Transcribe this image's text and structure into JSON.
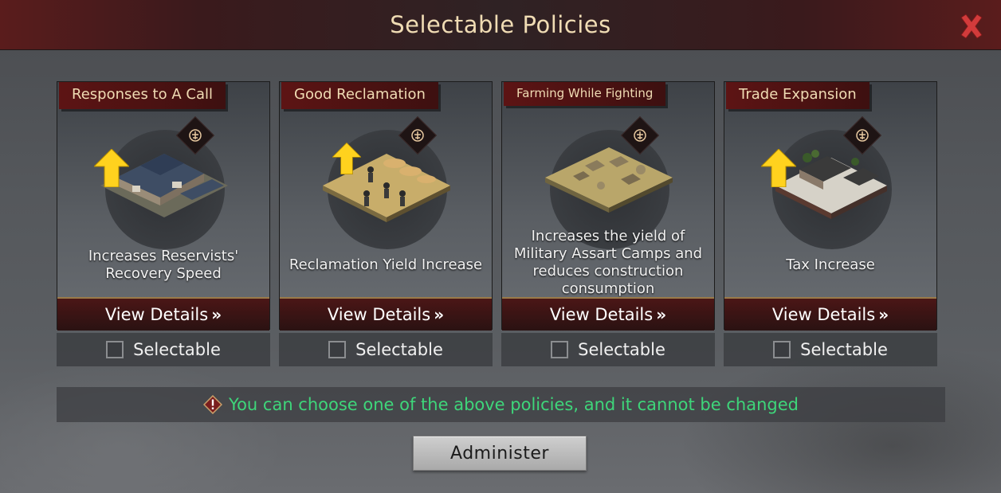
{
  "header": {
    "title": "Selectable Policies"
  },
  "close_icon": "close-x-icon",
  "policies": [
    {
      "title": "Responses to A Call",
      "description": "Increases Reservists' Recovery Speed",
      "details_label": "View Details",
      "selectable_label": "Selectable",
      "building": "barracks",
      "has_arrow": true
    },
    {
      "title": "Good Reclamation",
      "description": "Reclamation Yield Increase",
      "details_label": "View Details",
      "selectable_label": "Selectable",
      "building": "farm-field",
      "has_arrow": true
    },
    {
      "title": "Farming While Fighting",
      "description": "Increases the yield of Military Assart Camps and reduces construction consumption",
      "details_label": "View Details",
      "selectable_label": "Selectable",
      "building": "military-camp",
      "has_arrow": false
    },
    {
      "title": "Trade Expansion",
      "description": "Tax Increase",
      "details_label": "View Details",
      "selectable_label": "Selectable",
      "building": "market-house",
      "has_arrow": true
    }
  ],
  "notice": {
    "text": "You can choose one of the above policies, and it cannot be changed",
    "color": "#3ed67a"
  },
  "administer_button": {
    "label": "Administer"
  },
  "colors": {
    "title_gold": "#f0dcb4",
    "banner_red": "#5d1414",
    "close_red": "#d23b3b"
  }
}
